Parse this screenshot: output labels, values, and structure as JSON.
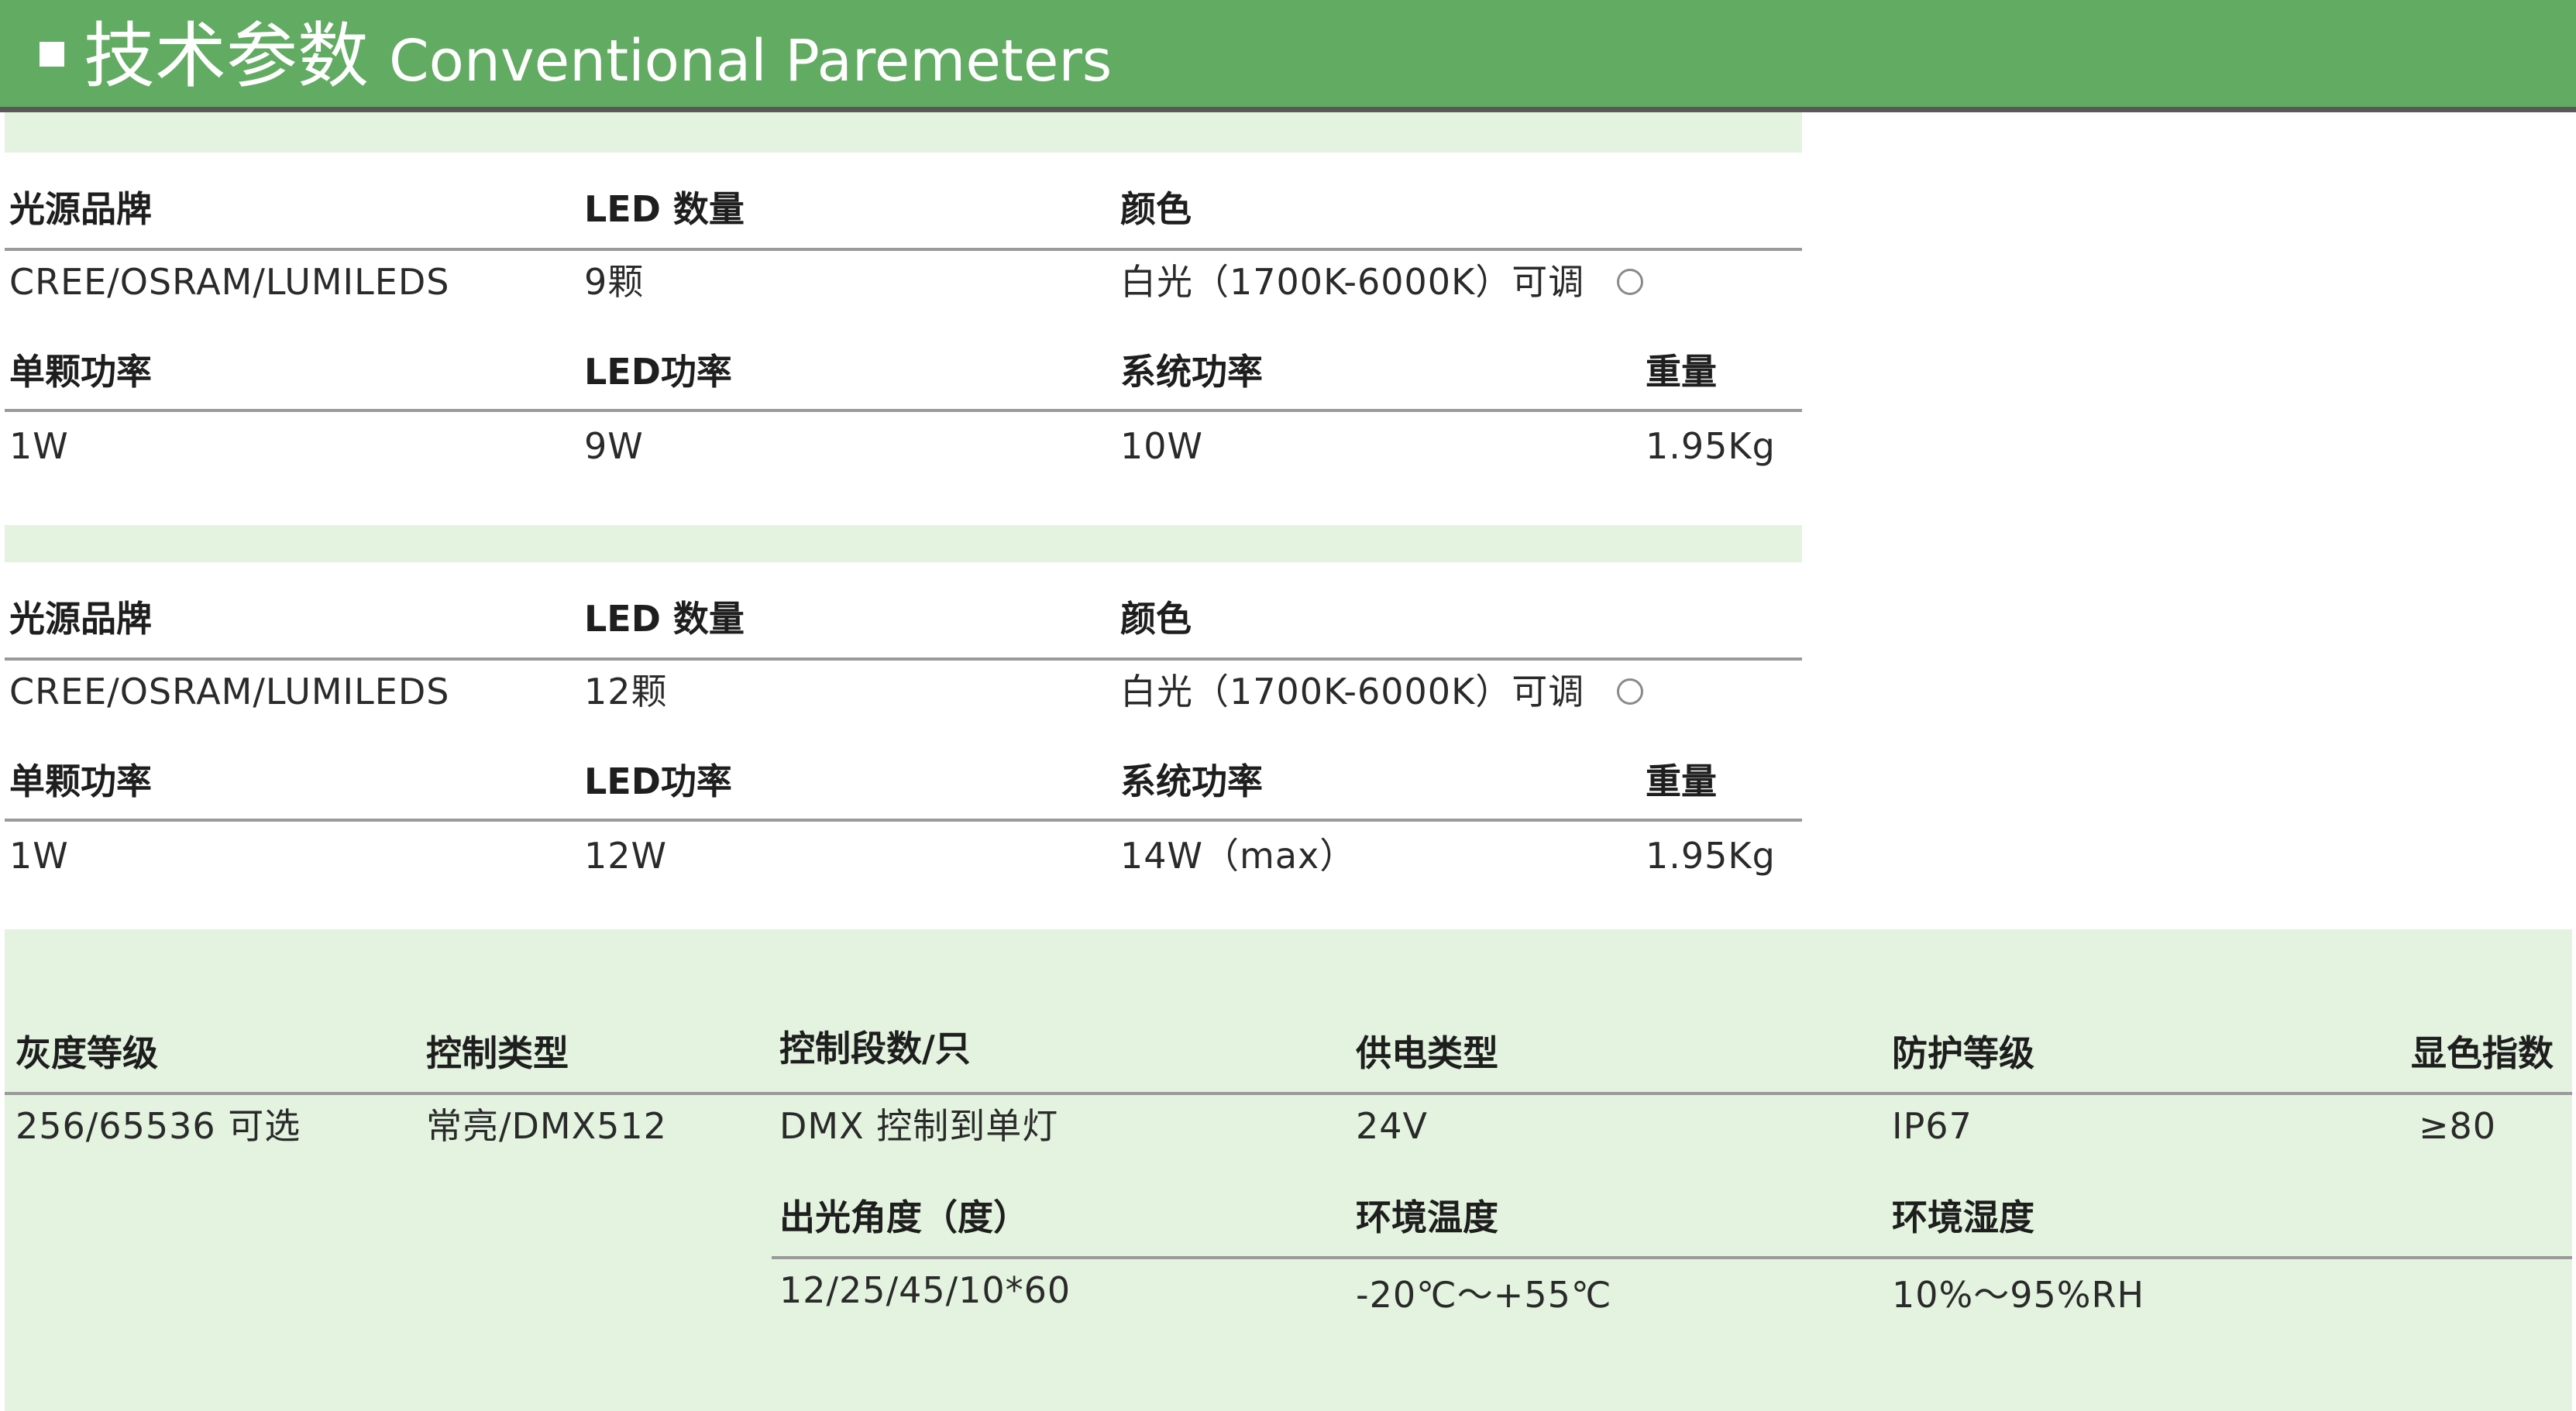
{
  "header": {
    "title_zh": "技术参数",
    "title_en": "Conventional Paremeters"
  },
  "spec_blocks": [
    {
      "labels_row1": [
        "光源品牌",
        "LED 数量",
        "颜色"
      ],
      "values_row1": [
        "CREE/OSRAM/LUMILEDS",
        "9颗",
        "白光（1700K-6000K）可调"
      ],
      "labels_row2": [
        "单颗功率",
        "LED功率",
        "系统功率",
        "重量"
      ],
      "values_row2": [
        "1W",
        "9W",
        "10W",
        "1.95Kg"
      ]
    },
    {
      "labels_row1": [
        "光源品牌",
        "LED 数量",
        "颜色"
      ],
      "values_row1": [
        "CREE/OSRAM/LUMILEDS",
        "12颗",
        "白光（1700K-6000K）可调"
      ],
      "labels_row2": [
        "单颗功率",
        "LED功率",
        "系统功率",
        "重量"
      ],
      "values_row2": [
        "1W",
        "12W",
        "14W（max）",
        "1.95Kg"
      ]
    }
  ],
  "common": {
    "labels_row1": [
      "灰度等级",
      "控制类型",
      "控制段数/只",
      "供电类型",
      "防护等级",
      "显色指数"
    ],
    "values_row1": [
      "256/65536 可选",
      "常亮/DMX512",
      "DMX 控制到单灯",
      "24V",
      "IP67",
      "≥80"
    ],
    "labels_row2": [
      "出光角度（度）",
      "环境温度",
      "环境湿度"
    ],
    "values_row2": [
      "12/25/45/10*60",
      "-20℃～+55℃",
      "10%～95%RH"
    ]
  },
  "colors": {
    "header_green": "#62ab62",
    "band_green": "#e3f3df"
  }
}
